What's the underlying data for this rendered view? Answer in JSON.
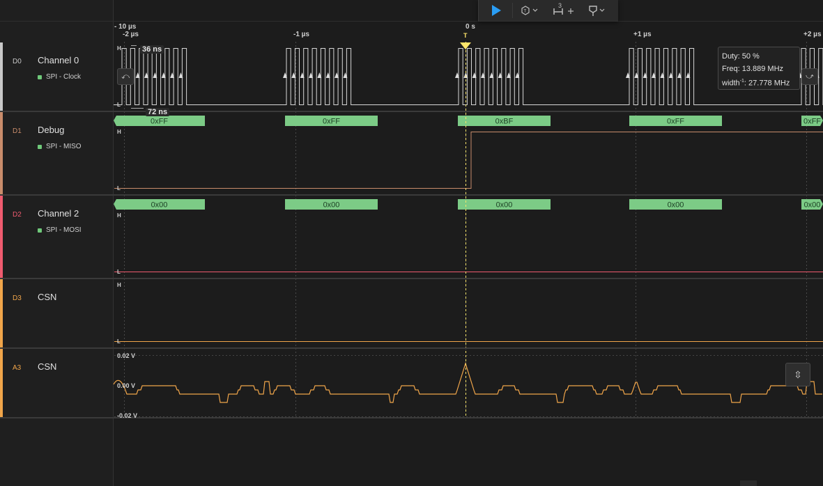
{
  "toolbar": {
    "items": [
      {
        "name": "run",
        "icon": "play-icon"
      },
      {
        "name": "trigger",
        "icon": "trigger-settings-icon"
      },
      {
        "name": "measure",
        "icon": "timing-measure-icon",
        "label": "3"
      },
      {
        "name": "marker",
        "icon": "marker-flag-icon"
      }
    ],
    "measure_count": "3",
    "plus": "+"
  },
  "timeline": {
    "scale": "- 10 µs",
    "ticks": [
      "-2 µs",
      "-1 µs",
      "0 s",
      "+1 µs",
      "+2 µs"
    ],
    "trigger_marker": "T"
  },
  "channels": [
    {
      "id": "D0",
      "name": "Channel 0",
      "protocol": "SPI - Clock",
      "color": "#c8c8c8"
    },
    {
      "id": "D1",
      "name": "Debug",
      "protocol": "SPI - MISO",
      "color": "#c98c6b"
    },
    {
      "id": "D2",
      "name": "Channel 2",
      "protocol": "SPI - MOSI",
      "color": "#ef5b6f"
    },
    {
      "id": "D3",
      "name": "CSN",
      "protocol": "",
      "color": "#f0a54a"
    },
    {
      "id": "A3",
      "name": "CSN",
      "protocol": "",
      "color": "#f0a54a"
    }
  ],
  "levels": {
    "high": "H",
    "low": "L"
  },
  "measurements": {
    "pulse_width": "36 ns",
    "period": "72 ns"
  },
  "tooltip": {
    "duty": "Duty: 50 %",
    "freq": "Freq: 13.889 MHz",
    "width_prefix": "width",
    "width_sup": "-1",
    "width_value": ": 27.778 MHz"
  },
  "miso_bytes": [
    "0xFF",
    "0xFF",
    "0xBF",
    "0xFF",
    "0xFF"
  ],
  "mosi_bytes": [
    "0x00",
    "0x00",
    "0x00",
    "0x00",
    "0x00"
  ],
  "analog": {
    "top": "0.02 V",
    "mid": "0.00 V",
    "bottom": "-0.02 V"
  },
  "colors": {
    "bus_fill": "#7ccb86",
    "analog_trace": "#f0a54a",
    "trigger": "#ffe66b",
    "run": "#2a9df4"
  }
}
